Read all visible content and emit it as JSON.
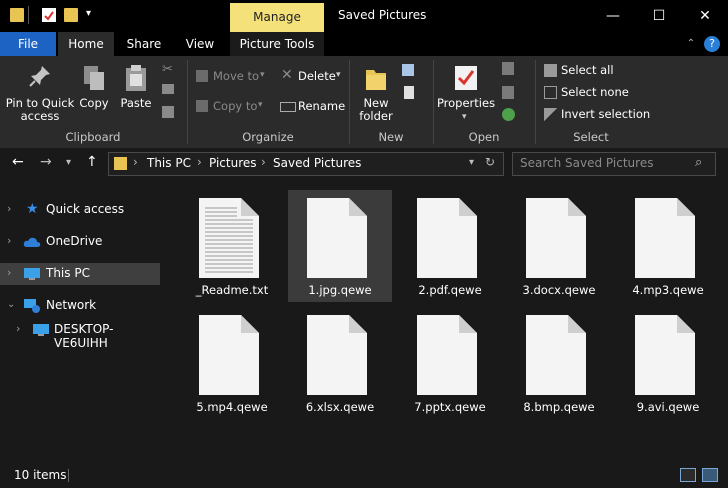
{
  "window": {
    "title": "Saved Pictures",
    "context_tab": "Manage",
    "minimize": "—",
    "maximize": "☐",
    "close": "✕"
  },
  "tabs": {
    "file": "File",
    "home": "Home",
    "share": "Share",
    "view": "View",
    "picture_tools": "Picture Tools"
  },
  "ribbon": {
    "clipboard": {
      "pin": "Pin to Quick access",
      "copy": "Copy",
      "paste": "Paste",
      "label": "Clipboard"
    },
    "organize": {
      "move_to": "Move to",
      "copy_to": "Copy to",
      "delete": "Delete",
      "rename": "Rename",
      "label": "Organize"
    },
    "new": {
      "new_folder": "New folder",
      "label": "New"
    },
    "open": {
      "properties": "Properties",
      "label": "Open"
    },
    "select": {
      "select_all": "Select all",
      "select_none": "Select none",
      "invert": "Invert selection",
      "label": "Select"
    }
  },
  "address": {
    "crumbs": [
      "This PC",
      "Pictures",
      "Saved Pictures"
    ],
    "search_placeholder": "Search Saved Pictures"
  },
  "sidebar": {
    "items": [
      {
        "label": "Quick access",
        "icon": "star-icon"
      },
      {
        "label": "OneDrive",
        "icon": "cloud-icon"
      },
      {
        "label": "This PC",
        "icon": "computer-icon",
        "selected": true
      },
      {
        "label": "Network",
        "icon": "network-icon",
        "expanded": true
      },
      {
        "label": "DESKTOP-VE6UIHH",
        "icon": "computer-icon"
      }
    ]
  },
  "files": [
    {
      "name": "_Readme.txt",
      "type": "text"
    },
    {
      "name": "1.jpg.qewe",
      "type": "blank",
      "selected": true
    },
    {
      "name": "2.pdf.qewe",
      "type": "blank"
    },
    {
      "name": "3.docx.qewe",
      "type": "blank"
    },
    {
      "name": "4.mp3.qewe",
      "type": "blank"
    },
    {
      "name": "5.mp4.qewe",
      "type": "blank"
    },
    {
      "name": "6.xlsx.qewe",
      "type": "blank"
    },
    {
      "name": "7.pptx.qewe",
      "type": "blank"
    },
    {
      "name": "8.bmp.qewe",
      "type": "blank"
    },
    {
      "name": "9.avi.qewe",
      "type": "blank"
    }
  ],
  "status": {
    "count": "10 items"
  }
}
